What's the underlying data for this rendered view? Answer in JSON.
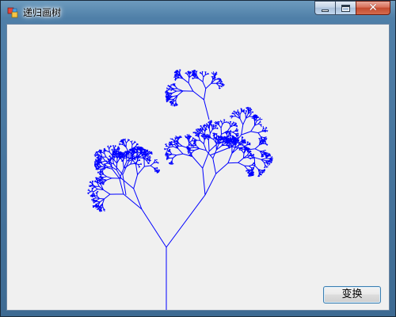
{
  "window": {
    "title": "递归画树"
  },
  "tree": {
    "stroke_color": "#0000ff"
  },
  "buttons": {
    "transform_label": "变换"
  },
  "icons": {
    "app": "app-icon",
    "minimize": "minimize-icon",
    "maximize": "maximize-icon",
    "close": "close-icon"
  }
}
